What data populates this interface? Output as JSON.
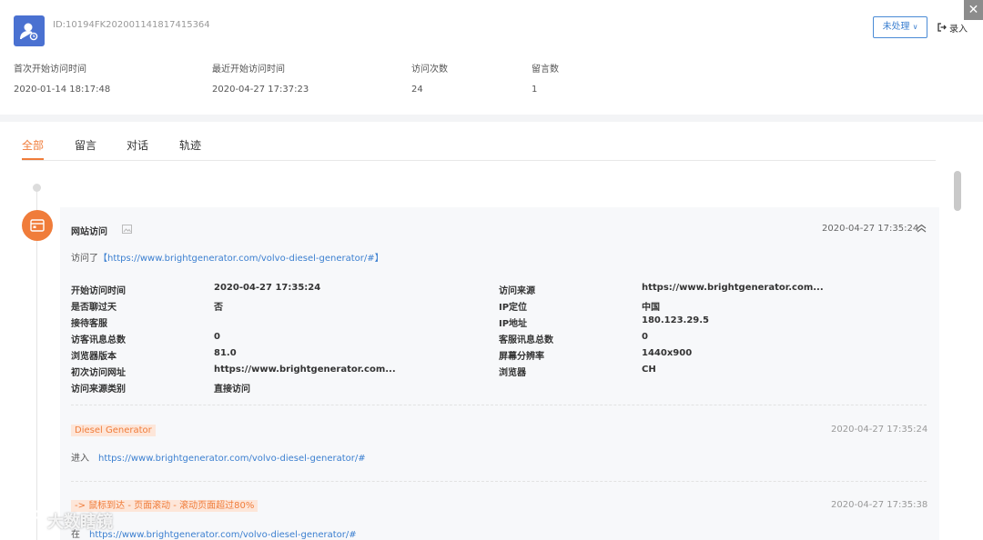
{
  "header": {
    "visitor_id": "ID:10194FK202001141817415364",
    "status_label": "未处理",
    "record_label": "录入",
    "close_symbol": "✕",
    "stats": [
      {
        "label": "首次开始访问时间",
        "value": "2020-01-14 18:17:48"
      },
      {
        "label": "最近开始访问时间",
        "value": "2020-04-27 17:37:23"
      },
      {
        "label": "访问次数",
        "value": "24"
      },
      {
        "label": "留言数",
        "value": "1"
      }
    ]
  },
  "tabs": [
    "全部",
    "留言",
    "对话",
    "轨迹"
  ],
  "active_tab": "全部",
  "card": {
    "title": "网站访问",
    "time": "2020-04-27 17:35:24",
    "visited_prefix": "访问了",
    "visited_open": "【",
    "visited_url": "https://www.brightgenerator.com/volvo-diesel-generator/#",
    "visited_close": "】",
    "left_fields": [
      {
        "label": "开始访问时间",
        "value": "2020-04-27 17:35:24"
      },
      {
        "label": "是否聊过天",
        "value": "否"
      },
      {
        "label": "接待客服",
        "value": ""
      },
      {
        "label": "访客讯息总数",
        "value": "0"
      },
      {
        "label": "浏览器版本",
        "value": "81.0"
      },
      {
        "label": "初次访问网址",
        "value": "https://www.brightgenerator.com..."
      },
      {
        "label": "访问来源类别",
        "value": "直接访问"
      }
    ],
    "right_fields": [
      {
        "label": "访问来源",
        "value": "https://www.brightgenerator.com..."
      },
      {
        "label": "IP定位",
        "value": "中国"
      },
      {
        "label": "IP地址",
        "value": "180.123.29.5"
      },
      {
        "label": "客服讯息总数",
        "value": "0"
      },
      {
        "label": "屏幕分辨率",
        "value": "1440x900"
      },
      {
        "label": "浏览器",
        "value": "CH"
      }
    ],
    "events": [
      {
        "tag": "Diesel Generator",
        "time": "2020-04-27 17:35:24",
        "verb": "进入",
        "url": "https://www.brightgenerator.com/volvo-diesel-generator/#"
      },
      {
        "tag": "-> 鼠标到达 - 页面滚动 - 滚动页面超过80%",
        "time": "2020-04-27 17:35:38",
        "verb": "在",
        "url": "https://www.brightgenerator.com/volvo-diesel-generator/#"
      }
    ]
  },
  "watermark": "大数瞎镜",
  "colors": {
    "accent_orange": "#f07c3a",
    "link_blue": "#3b7fd0",
    "avatar_blue": "#4a71d1",
    "card_bg": "#f7f8fa"
  }
}
